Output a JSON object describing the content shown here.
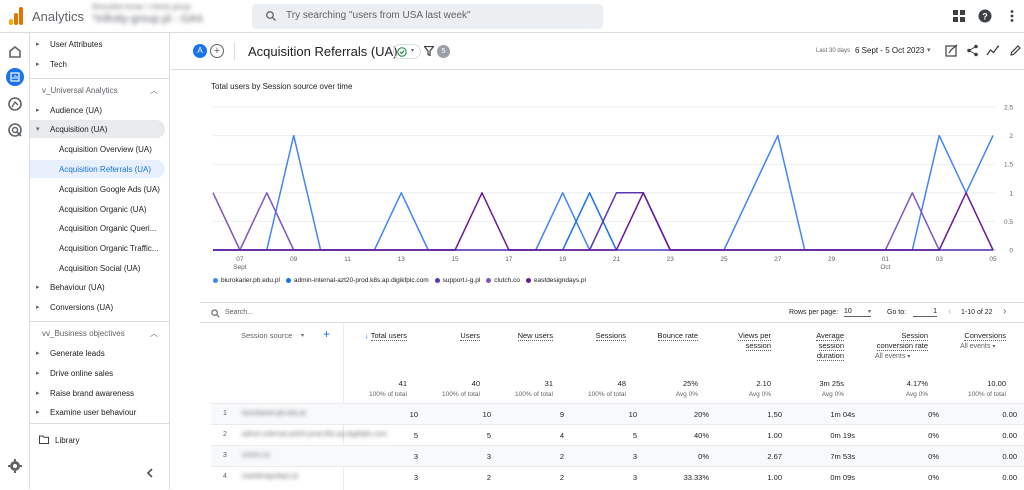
{
  "app": {
    "title": "Analytics",
    "account_line1": "Wszystkie konta > Infinity group",
    "account_line2": "*infinity-group.pl - GA4",
    "search_placeholder": "Try searching \"users from USA last week\""
  },
  "nav": {
    "items_top": [
      {
        "label": "User Attributes"
      },
      {
        "label": "Tech"
      }
    ],
    "section1": "v_Universal Analytics",
    "items_ua": [
      {
        "label": "Audience (UA)"
      },
      {
        "label": "Acquisition (UA)"
      }
    ],
    "subitems": [
      {
        "label": "Acquisition Overview (UA)"
      },
      {
        "label": "Acquisition Referrals (UA)"
      },
      {
        "label": "Acquisition Google Ads (UA)"
      },
      {
        "label": "Acquisition Organic (UA)"
      },
      {
        "label": "Acquisition Organic Queri..."
      },
      {
        "label": "Acquisition Organic Traffic..."
      },
      {
        "label": "Acquisition Social (UA)"
      }
    ],
    "items_ua2": [
      {
        "label": "Behaviour (UA)"
      },
      {
        "label": "Conversions (UA)"
      }
    ],
    "section2": "vv_Business objectives",
    "items_biz": [
      {
        "label": "Generate leads"
      },
      {
        "label": "Drive online sales"
      },
      {
        "label": "Raise brand awareness"
      },
      {
        "label": "Examine user behaviour"
      }
    ],
    "library": "Library"
  },
  "header": {
    "avatar": "A",
    "add": "+",
    "title": "Acquisition Referrals (UA)",
    "filter_count": "5",
    "date_small": "Last 30 days",
    "date_range": "6 Sept - 5 Oct 2023"
  },
  "chart_data": {
    "type": "line",
    "title": "Total users by Session source over time",
    "x": [
      "06 Sept",
      "07 Sept",
      "08 Sept",
      "09 Sept",
      "10 Sept",
      "11 Sept",
      "12 Sept",
      "13 Sept",
      "14 Sept",
      "15 Sept",
      "16 Sept",
      "17 Sept",
      "18 Sept",
      "19 Sept",
      "20 Sept",
      "21 Sept",
      "22 Sept",
      "23 Sept",
      "24 Sept",
      "25 Sept",
      "26 Sept",
      "27 Sept",
      "28 Sept",
      "29 Sept",
      "30 Sept",
      "01 Oct",
      "02 Oct",
      "03 Oct",
      "04 Oct",
      "05 Oct"
    ],
    "x_tick_labels": [
      "07",
      "09",
      "11",
      "13",
      "15",
      "17",
      "19",
      "21",
      "23",
      "25",
      "27",
      "29",
      "01",
      "03",
      "05"
    ],
    "x_tick_sublabels": {
      "07": "Sept",
      "01": "Oct"
    },
    "y_ticks": [
      "0",
      "0.5",
      "1",
      "1.5",
      "2",
      "2.5"
    ],
    "ylim": [
      0,
      2.5
    ],
    "series": [
      {
        "name": "biurokarier.pb.edu.pl",
        "color": "#4285f4",
        "values": [
          0,
          0,
          0,
          2,
          0,
          0,
          0,
          1,
          0,
          0,
          0,
          0,
          0,
          1,
          0,
          0,
          0,
          0,
          0,
          0,
          1,
          2,
          0,
          0,
          0,
          0,
          0,
          2,
          1,
          2
        ]
      },
      {
        "name": "admin-internal-azt20-prod.k8s.ap.digikfplc.com",
        "color": "#1a73e8",
        "values": [
          0,
          0,
          0,
          0,
          0,
          0,
          0,
          0,
          0,
          0,
          0,
          0,
          0,
          0,
          1,
          0,
          0,
          0,
          0,
          0,
          0,
          0,
          0,
          0,
          0,
          0,
          0,
          0,
          0,
          0
        ]
      },
      {
        "name": "support.i-g.pl",
        "color": "#5e35b1",
        "values": [
          0,
          0,
          0,
          0,
          0,
          0,
          0,
          0,
          0,
          0,
          0,
          0,
          0,
          0,
          0,
          1,
          1,
          0,
          0,
          0,
          0,
          0,
          0,
          0,
          0,
          0,
          0,
          0,
          0,
          0
        ]
      },
      {
        "name": "clutch.co",
        "color": "#7e57c2",
        "values": [
          1,
          0,
          1,
          0,
          0,
          0,
          0,
          0,
          0,
          0,
          0,
          0,
          0,
          0,
          0,
          0,
          0,
          0,
          0,
          0,
          0,
          0,
          0,
          0,
          0,
          0,
          1,
          0,
          0,
          0
        ]
      },
      {
        "name": "eastdesigndays.pl",
        "color": "#6a1b9a",
        "values": [
          0,
          0,
          0,
          0,
          0,
          0,
          0,
          0,
          0,
          0,
          1,
          0,
          0,
          0,
          0,
          0,
          1,
          0,
          0,
          0,
          0,
          0,
          0,
          0,
          0,
          0,
          0,
          0,
          1,
          0
        ]
      }
    ]
  },
  "table": {
    "search_placeholder": "Search...",
    "rows_per_page_label": "Rows per page:",
    "rows_per_page": "10",
    "goto_label": "Go to:",
    "goto_value": "1",
    "pagination": "1-10 of 22",
    "dimension_header": "Session source",
    "add_dimension": "+",
    "columns": [
      {
        "label": "Total users",
        "total": "41",
        "total_sub": "100% of total"
      },
      {
        "label": "Users",
        "total": "40",
        "total_sub": "100% of total"
      },
      {
        "label": "New users",
        "total": "31",
        "total_sub": "100% of total"
      },
      {
        "label": "Sessions",
        "total": "48",
        "total_sub": "100% of total"
      },
      {
        "label": "Bounce rate",
        "total": "25%",
        "total_sub": "Avg 0%"
      },
      {
        "label1": "Views per",
        "label2": "session",
        "total": "2.10",
        "total_sub": "Avg 0%"
      },
      {
        "label1": "Average",
        "label2": "session",
        "label3": "duration",
        "total": "3m 25s",
        "total_sub": "Avg 0%"
      },
      {
        "label1": "Session",
        "label2": "conversion rate",
        "selector": "All events",
        "total": "4.17%",
        "total_sub": "Avg 0%"
      },
      {
        "label1": "Conversions",
        "selector": "All events",
        "total": "10.00",
        "total_sub": "100% of total"
      }
    ],
    "rows": [
      {
        "n": "1",
        "source": "biurokarier.pb.edu.pl",
        "vals": [
          "10",
          "10",
          "9",
          "10",
          "20%",
          "1.50",
          "1m 04s",
          "0%",
          "0.00"
        ]
      },
      {
        "n": "2",
        "source": "admin-internal-azt20-prod.k8s.ap.digikfplc.com",
        "vals": [
          "5",
          "5",
          "4",
          "5",
          "40%",
          "1.00",
          "0m 19s",
          "0%",
          "0.00"
        ]
      },
      {
        "n": "3",
        "source": "clutch.co",
        "vals": [
          "3",
          "3",
          "2",
          "3",
          "0%",
          "2.67",
          "7m 53s",
          "0%",
          "0.00"
        ]
      },
      {
        "n": "4",
        "source": "eastdesigndays.pl",
        "vals": [
          "3",
          "2",
          "2",
          "3",
          "33.33%",
          "1.00",
          "0m 09s",
          "0%",
          "0.00"
        ]
      }
    ]
  }
}
